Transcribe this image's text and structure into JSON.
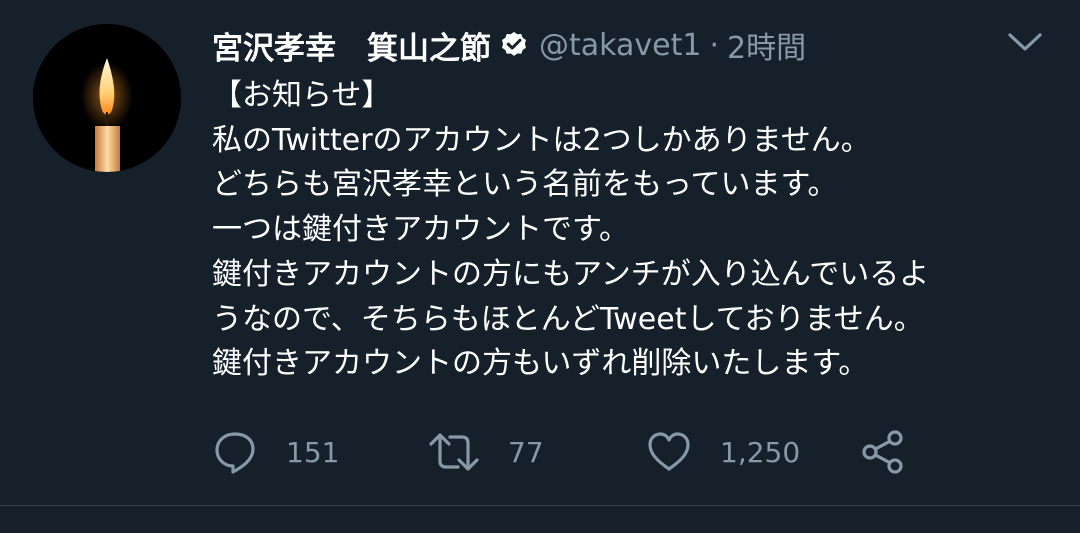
{
  "tweet": {
    "display_name": "宮沢孝幸　箕山之節",
    "verified": true,
    "handle": "@takavet1",
    "separator": "·",
    "time": "2時間",
    "lines": [
      "【お知らせ】",
      "私のTwitterのアカウントは2つしかありません。",
      "どちらも宮沢孝幸という名前をもっています。",
      "一つは鍵付きアカウントです。",
      "鍵付きアカウントの方にもアンチが入り込んでいるよ",
      "うなので、そちらもほとんどTweetしておりません。",
      "鍵付きアカウントの方もいずれ削除いたします。"
    ],
    "avatar_icon": "candle-icon",
    "reply_count": "151",
    "retweet_count": "77",
    "like_count": "1,250"
  },
  "colors": {
    "background": "#15202b",
    "primary_text": "#ffffff",
    "secondary_text": "#8899a6",
    "divider": "#38444d"
  }
}
